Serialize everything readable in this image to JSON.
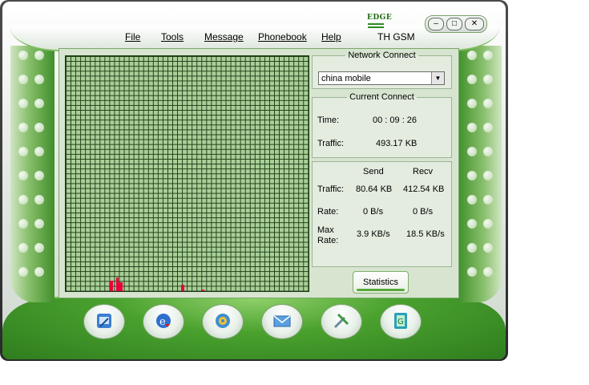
{
  "menu": {
    "file": "File",
    "tools": "Tools",
    "message": "Message",
    "phonebook": "Phonebook",
    "help": "Help"
  },
  "status": {
    "network_type": "EDGE",
    "operator": "TH GSM"
  },
  "network_connect": {
    "legend": "Network Connect",
    "selected": "china mobile"
  },
  "current_connect": {
    "legend": "Current Connect",
    "time_label": "Time:",
    "time_value": "00 : 09 : 26",
    "traffic_label": "Traffic:",
    "traffic_value": "493.17 KB"
  },
  "stats": {
    "send_header": "Send",
    "recv_header": "Recv",
    "traffic_label": "Traffic:",
    "traffic_send": "80.64 KB",
    "traffic_recv": "412.54 KB",
    "rate_label": "Rate:",
    "rate_send": "0 B/s",
    "rate_recv": "0 B/s",
    "max_rate_label_1": "Max",
    "max_rate_label_2": "Rate:",
    "max_send": "3.9 KB/s",
    "max_recv": "18.5 KB/s"
  },
  "buttons": {
    "statistics": "Statistics"
  },
  "colors": {
    "accent_green": "#4aa12e",
    "graph_bg": "#a9cf98",
    "graph_bar": "#e8003a"
  },
  "bottom_icons": [
    "connect-icon",
    "internet-icon",
    "settings-icon",
    "sms-icon",
    "tools-icon",
    "phonebook-icon"
  ]
}
